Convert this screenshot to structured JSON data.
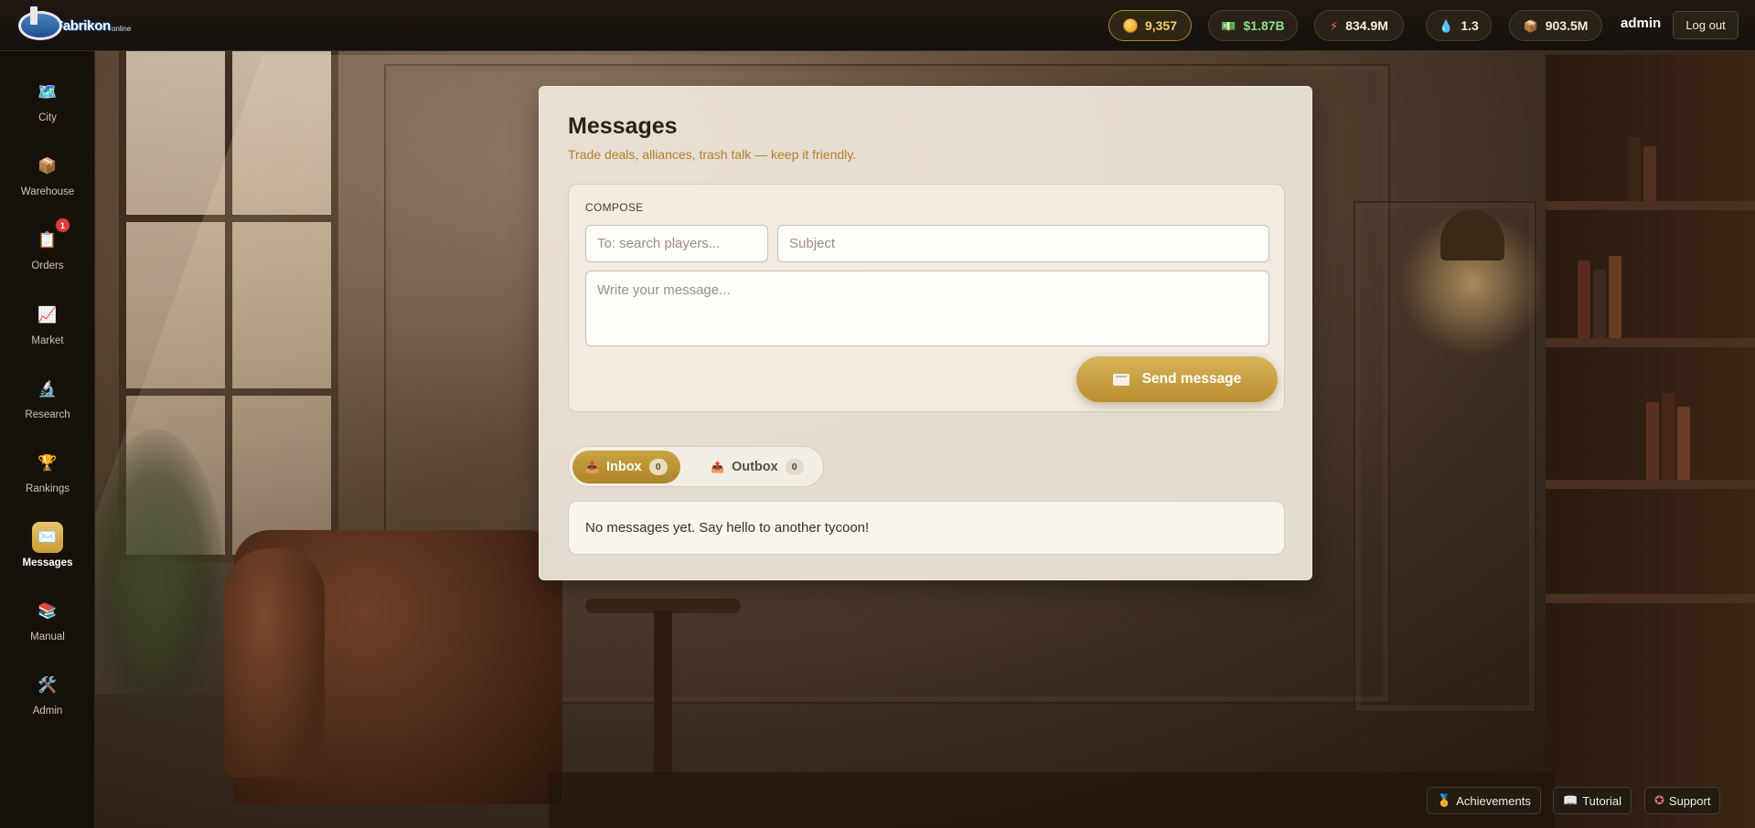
{
  "app": {
    "logo_text": "Fabrikon",
    "logo_sub": "online"
  },
  "stats": {
    "coins": "9,357",
    "cash": "$1.87B",
    "energy": "834.9M",
    "water": "1.3",
    "goods": "903.5M"
  },
  "user": {
    "name": "admin",
    "logout_label": "Log out"
  },
  "sidebar": {
    "items": [
      {
        "label": "City",
        "icon": "map-icon"
      },
      {
        "label": "Warehouse",
        "icon": "box-icon"
      },
      {
        "label": "Orders",
        "icon": "clipboard-icon",
        "badge": "1"
      },
      {
        "label": "Market",
        "icon": "chart-icon"
      },
      {
        "label": "Research",
        "icon": "microscope-icon"
      },
      {
        "label": "Rankings",
        "icon": "trophy-icon"
      },
      {
        "label": "Messages",
        "icon": "envelope-icon",
        "active": true
      },
      {
        "label": "Manual",
        "icon": "books-icon"
      },
      {
        "label": "Admin",
        "icon": "tools-icon"
      }
    ]
  },
  "messages": {
    "title": "Messages",
    "subtitle": "Trade deals, alliances, trash talk — keep it friendly.",
    "compose_label": "COMPOSE",
    "to_placeholder": "To: search players...",
    "subject_placeholder": "Subject",
    "body_placeholder": "Write your message...",
    "send_label": "Send message",
    "tabs": [
      {
        "label": "Inbox",
        "count": "0",
        "active": true
      },
      {
        "label": "Outbox",
        "count": "0"
      }
    ],
    "empty_text": "No messages yet. Say hello to another tycoon!"
  },
  "footer": {
    "achievements": "Achievements",
    "tutorial": "Tutorial",
    "support": "Support"
  },
  "colors": {
    "accent": "#c99c36",
    "badge": "#e03b3b",
    "cash": "#8ee08a",
    "coins": "#f6cf6a"
  }
}
